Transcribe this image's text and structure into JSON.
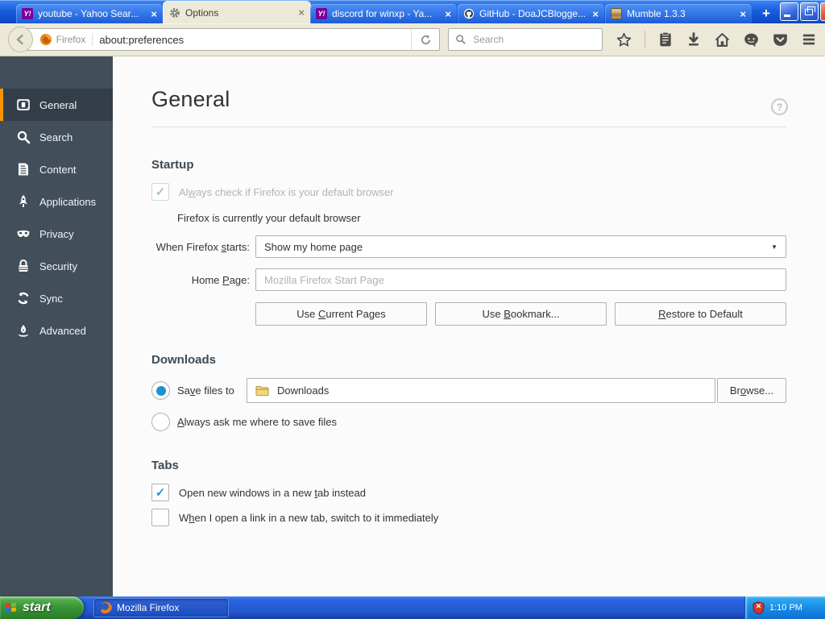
{
  "colors": {
    "accent_orange": "#ff9400",
    "sidebar_bg": "#424f5a",
    "titlebar_blue": "#1a5ede",
    "check_blue": "#2195d3",
    "toolbar_cream": "#ece9d8"
  },
  "glyphs": {
    "close": "×",
    "check": "✓",
    "caret": "▼",
    "new_tab": "+",
    "help": "?"
  },
  "titlebar": {
    "tabs": [
      {
        "title": "youtube - Yahoo Sear...",
        "icon": "yahoo"
      },
      {
        "title": "Options",
        "icon": "gear"
      },
      {
        "title": "discord for winxp - Ya...",
        "icon": "yahoo"
      },
      {
        "title": "GitHub - DoaJCBlogge...",
        "icon": "github"
      },
      {
        "title": "Mumble 1.3.3",
        "icon": "mumble"
      }
    ]
  },
  "navbar": {
    "identity_label": "Firefox",
    "url": "about:preferences",
    "search_placeholder": "Search"
  },
  "sidebar": {
    "items": [
      {
        "label": "General",
        "active": true
      },
      {
        "label": "Search"
      },
      {
        "label": "Content"
      },
      {
        "label": "Applications"
      },
      {
        "label": "Privacy"
      },
      {
        "label": "Security"
      },
      {
        "label": "Sync"
      },
      {
        "label": "Advanced"
      }
    ]
  },
  "main": {
    "title": "General",
    "startup": {
      "heading": "Startup",
      "always_check": {
        "pre": "Al",
        "key": "w",
        "post": "ays check if Firefox is your default browser"
      },
      "default_browser_status": "Firefox is currently your default browser",
      "when_starts_label": {
        "pre": "When Firefox ",
        "key": "s",
        "post": "tarts:"
      },
      "when_starts_value": "Show my home page",
      "home_page_label": {
        "pre": "Home ",
        "key": "P",
        "post": "age:"
      },
      "home_page_placeholder": "Mozilla Firefox Start Page",
      "use_current": {
        "pre": "Use ",
        "key": "C",
        "post": "urrent Pages"
      },
      "use_bookmark": {
        "pre": "Use ",
        "key": "B",
        "post": "ookmark..."
      },
      "restore_default": {
        "pre": "",
        "key": "R",
        "post": "estore to Default"
      }
    },
    "downloads": {
      "heading": "Downloads",
      "save_files_label": {
        "pre": "Sa",
        "key": "v",
        "post": "e files to"
      },
      "folder_value": "Downloads",
      "browse_label": {
        "pre": "Br",
        "key": "o",
        "post": "wse..."
      },
      "always_ask_label": {
        "pre": "",
        "key": "A",
        "post": "lways ask me where to save files"
      }
    },
    "tabs_section": {
      "heading": "Tabs",
      "open_windows_label": {
        "pre": "Open new windows in a new ",
        "key": "t",
        "post": "ab instead"
      },
      "switch_label": {
        "pre": "W",
        "key": "h",
        "post": "en I open a link in a new tab, switch to it immediately"
      }
    }
  },
  "taskbar": {
    "start_label": "start",
    "task_button_label": "Mozilla Firefox",
    "time": "1:10 PM"
  }
}
